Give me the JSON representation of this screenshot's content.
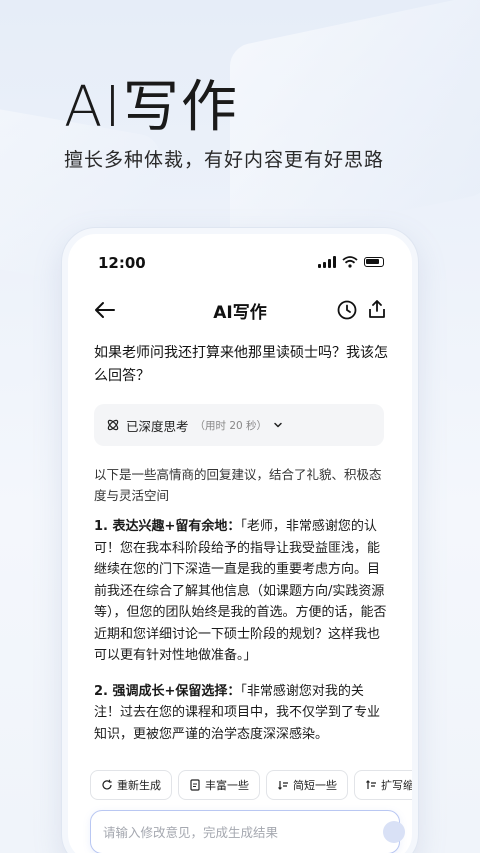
{
  "promo": {
    "title": "AI写作",
    "subtitle": "擅长多种体裁，有好内容更有好思路"
  },
  "status": {
    "time": "12:00"
  },
  "nav": {
    "title": "AI写作"
  },
  "chat": {
    "question": "如果老师问我还打算来他那里读硕士吗？我该怎么回答？",
    "thinking_label": "已深度思考",
    "thinking_time": "（用时 20 秒）",
    "intro": "以下是一些高情商的回复建议，结合了礼貌、积极态度与灵活空间",
    "p1_heading": "1. 表达兴趣+留有余地：",
    "p1_body": "「老师，非常感谢您的认可！您在我本科阶段给予的指导让我受益匪浅，能继续在您的门下深造一直是我的重要考虑方向。目前我还在综合了解其他信息（如课题方向/实践资源等），但您的团队始终是我的首选。方便的话，能否近期和您详细讨论一下硕士阶段的规划？这样我也可以更有针对性地做准备。」",
    "p2_heading": "2. 强调成长+保留选择：",
    "p2_body": "「非常感谢您对我的关注！过去在您的课程和项目中，我不仅学到了专业知识，更被您严谨的治学态度深深感染。"
  },
  "toolbar": {
    "regenerate": "重新生成",
    "richer": "丰富一些",
    "shorter": "简短一些",
    "expand": "扩写缩"
  },
  "input": {
    "placeholder": "请输入修改意见，完成生成结果"
  },
  "colors": {
    "accent": "#b9c7f2",
    "background": "#edf2fa"
  }
}
